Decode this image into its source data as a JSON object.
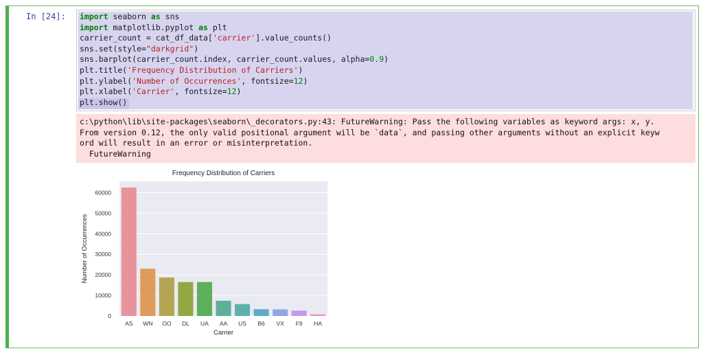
{
  "cell": {
    "prompt": "In [24]:",
    "code_lines": [
      [
        {
          "t": "import",
          "c": "kw"
        },
        {
          "t": " seaborn "
        },
        {
          "t": "as",
          "c": "kw"
        },
        {
          "t": " sns"
        }
      ],
      [
        {
          "t": "import",
          "c": "kw"
        },
        {
          "t": " matplotlib.pyplot "
        },
        {
          "t": "as",
          "c": "kw"
        },
        {
          "t": " plt"
        }
      ],
      [
        {
          "t": "carrier_count = cat_df_data["
        },
        {
          "t": "'carrier'",
          "c": "str"
        },
        {
          "t": "].value_counts()"
        }
      ],
      [
        {
          "t": "sns.set(style="
        },
        {
          "t": "\"darkgrid\"",
          "c": "str"
        },
        {
          "t": ")"
        }
      ],
      [
        {
          "t": "sns.barplot(carrier_count.index, carrier_count.values, alpha="
        },
        {
          "t": "0.9",
          "c": "num"
        },
        {
          "t": ")"
        }
      ],
      [
        {
          "t": "plt.title("
        },
        {
          "t": "'Frequency Distribution of Carriers'",
          "c": "str"
        },
        {
          "t": ")"
        }
      ],
      [
        {
          "t": "plt.ylabel("
        },
        {
          "t": "'Number of Occurrences'",
          "c": "str"
        },
        {
          "t": ", fontsize="
        },
        {
          "t": "12",
          "c": "num"
        },
        {
          "t": ")"
        }
      ],
      [
        {
          "t": "plt.xlabel("
        },
        {
          "t": "'Carrier'",
          "c": "str"
        },
        {
          "t": ", fontsize="
        },
        {
          "t": "12",
          "c": "num"
        },
        {
          "t": ")"
        }
      ],
      [
        {
          "t": "plt.show()"
        }
      ]
    ],
    "stderr_lines": [
      "c:\\python\\lib\\site-packages\\seaborn\\_decorators.py:43: FutureWarning: Pass the following variables as keyword args: x, y.",
      "From version 0.12, the only valid positional argument will be `data`, and passing other arguments without an explicit keyw",
      "ord will result in an error or misinterpretation.",
      "  FutureWarning"
    ]
  },
  "colors": {
    "cell_border": "#4caf50",
    "prompt": "#303f9f",
    "stderr_bg": "#fddddd",
    "plot_bg": "#eaeaf2"
  },
  "chart_data": {
    "type": "bar",
    "title": "Frequency Distribution of Carriers",
    "xlabel": "Carrier",
    "ylabel": "Number of Occurrences",
    "categories": [
      "AS",
      "WN",
      "OO",
      "DL",
      "UA",
      "AA",
      "US",
      "B6",
      "VX",
      "F9",
      "HA"
    ],
    "values": [
      62500,
      23000,
      18700,
      16500,
      16500,
      7400,
      5800,
      3300,
      3200,
      2600,
      800
    ],
    "colors": [
      "#e8939c",
      "#df9b5a",
      "#b3a552",
      "#93a844",
      "#5cb05c",
      "#5cb09a",
      "#5db1ad",
      "#5fabc8",
      "#8fa7e0",
      "#c79ae5",
      "#e594cc"
    ],
    "yticks": [
      0,
      10000,
      20000,
      30000,
      40000,
      50000,
      60000
    ],
    "ylim": [
      0,
      65500
    ],
    "grid": true
  }
}
